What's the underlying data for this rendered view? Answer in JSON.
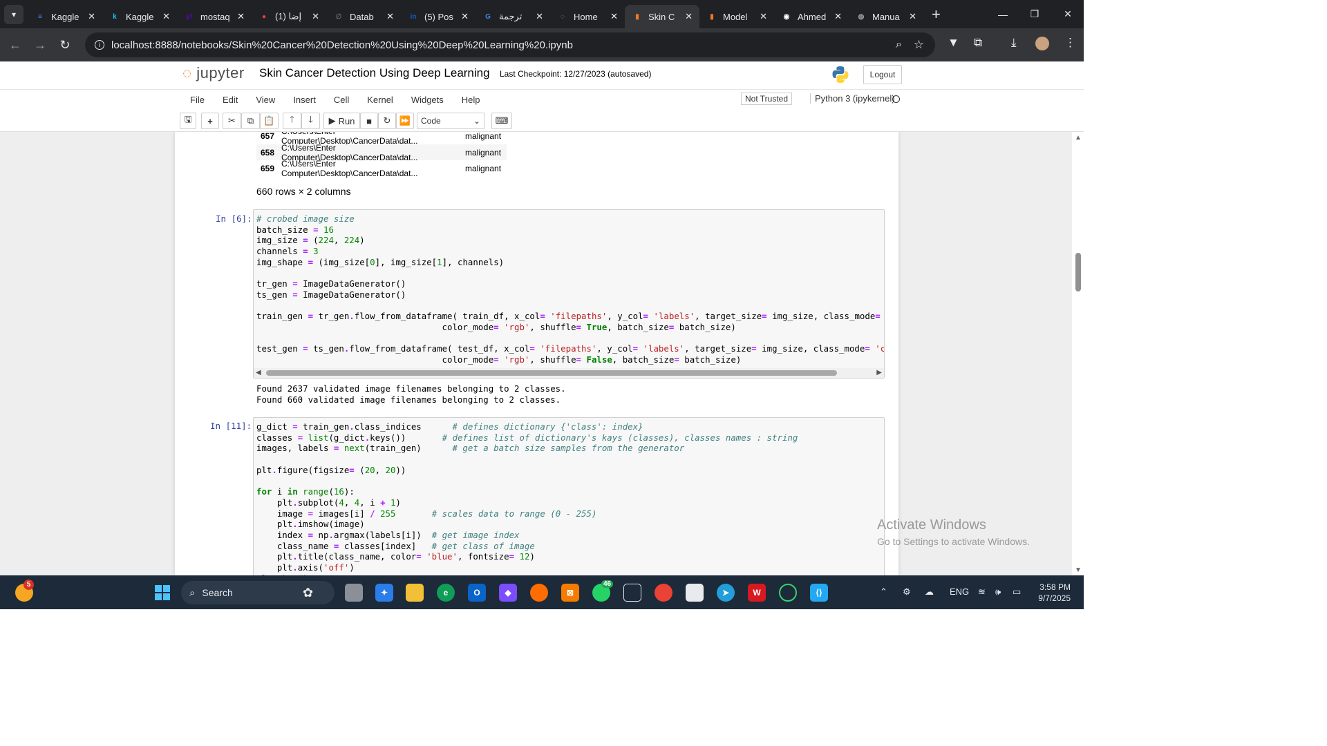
{
  "browser": {
    "tabs": [
      {
        "label": "Kaggle",
        "icon": "docs-icon",
        "color": "#4285f4",
        "glyph": "≡"
      },
      {
        "label": "Kaggle",
        "icon": "kaggle-icon",
        "color": "#20beff",
        "glyph": "k"
      },
      {
        "label": "mostaq",
        "icon": "yahoo-icon",
        "color": "#6001d2",
        "glyph": "y!"
      },
      {
        "label": "(1) إضا",
        "icon": "site-icon",
        "color": "#ea4335",
        "glyph": "●"
      },
      {
        "label": "Datab",
        "icon": "link-icon",
        "color": "#5f6368",
        "glyph": "∅"
      },
      {
        "label": "(5) Pos",
        "icon": "linkedin-icon",
        "color": "#0a66c2",
        "glyph": "in"
      },
      {
        "label": "ترجمة",
        "icon": "translate-icon",
        "color": "#4285f4",
        "glyph": "G"
      },
      {
        "label": "Home",
        "icon": "jupyter-tab-icon",
        "color": "#f37726",
        "glyph": "◌"
      },
      {
        "label": "Skin C",
        "icon": "notebook-tab-icon",
        "color": "#f37726",
        "glyph": "▮"
      },
      {
        "label": "Model",
        "icon": "notebook-tab-icon",
        "color": "#f37726",
        "glyph": "▮"
      },
      {
        "label": "Ahmed",
        "icon": "github-icon",
        "color": "#ffffff",
        "glyph": "◉"
      },
      {
        "label": "Manua",
        "icon": "globe-icon",
        "color": "#9aa0a6",
        "glyph": "◍"
      }
    ],
    "active_tab_index": 8,
    "url": "localhost:8888/notebooks/Skin%20Cancer%20Detection%20Using%20Deep%20Learning%20.ipynb"
  },
  "jupyter": {
    "logo_text": "jupyter",
    "notebook_title": "Skin Cancer Detection Using Deep Learning",
    "checkpoint": "Last Checkpoint: 12/27/2023  (autosaved)",
    "logout_label": "Logout",
    "menu": [
      "File",
      "Edit",
      "View",
      "Insert",
      "Cell",
      "Kernel",
      "Widgets",
      "Help"
    ],
    "trust_label": "Not Trusted",
    "kernel_label": "Python 3 (ipykernel)",
    "run_label": "Run",
    "cell_type": "Code"
  },
  "dataframe_tail": {
    "rows": [
      {
        "index": "657",
        "filepath": "C:\\Users\\Enter Computer\\Desktop\\CancerData\\dat...",
        "label": "malignant"
      },
      {
        "index": "658",
        "filepath": "C:\\Users\\Enter Computer\\Desktop\\CancerData\\dat...",
        "label": "malignant"
      },
      {
        "index": "659",
        "filepath": "C:\\Users\\Enter Computer\\Desktop\\CancerData\\dat...",
        "label": "malignant"
      }
    ],
    "shape_text": "660 rows × 2 columns"
  },
  "cells": [
    {
      "prompt": "In [6]:",
      "output": "Found 2637 validated image filenames belonging to 2 classes.\nFound 660 validated image filenames belonging to 2 classes."
    },
    {
      "prompt": "In [11]:"
    }
  ],
  "watermark": {
    "title": "Activate Windows",
    "subtitle": "Go to Settings to activate Windows."
  },
  "taskbar": {
    "search_label": "Search",
    "notification_badge": "5",
    "whatsapp_badge": "46",
    "language": "ENG",
    "time": "3:58 PM",
    "date": "9/7/2025"
  }
}
